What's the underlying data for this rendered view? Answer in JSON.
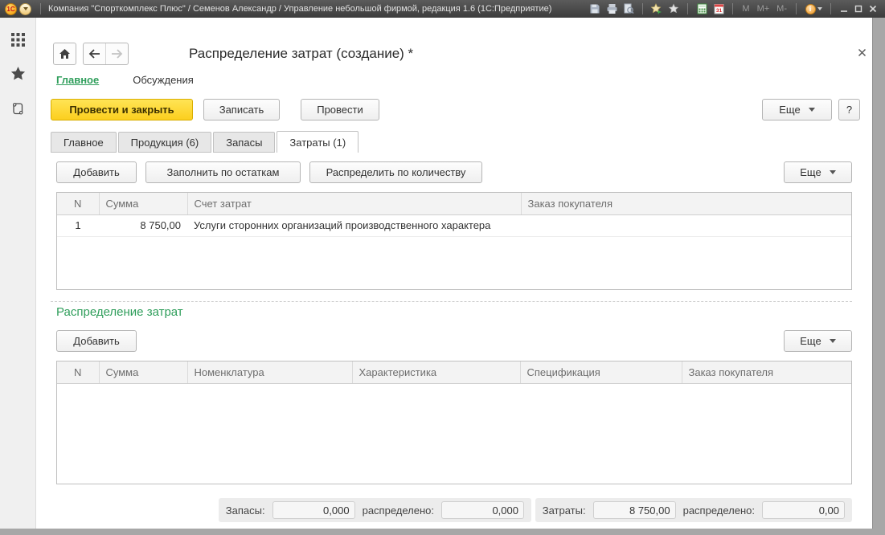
{
  "titlebar": {
    "logo_text": "1С",
    "title": "Компания \"Спорткомплекс Плюс\" / Семенов Александр / Управление небольшой фирмой, редакция 1.6  (1С:Предприятие)",
    "calendar_text": "31",
    "memory": [
      "M",
      "M+",
      "M-"
    ]
  },
  "form": {
    "title": "Распределение затрат (создание) *",
    "nav": {
      "main": "Главное",
      "discussions": "Обсуждения"
    }
  },
  "commands": {
    "post_and_close": "Провести и закрыть",
    "write": "Записать",
    "post": "Провести",
    "more": "Еще",
    "help": "?"
  },
  "tabs": [
    {
      "label": "Главное"
    },
    {
      "label": "Продукция (6)"
    },
    {
      "label": "Запасы"
    },
    {
      "label": "Затраты (1)"
    }
  ],
  "costs_section": {
    "toolbar": {
      "add": "Добавить",
      "fill_by_balance": "Заполнить по остаткам",
      "distribute_by_qty": "Распределить по количеству",
      "more": "Еще"
    },
    "table": {
      "columns": [
        "N",
        "Сумма",
        "Счет затрат",
        "Заказ покупателя"
      ],
      "rows": [
        {
          "n": "1",
          "sum": "8 750,00",
          "account": "Услуги сторонних организаций производственного характера",
          "order": ""
        }
      ]
    }
  },
  "distribution_section": {
    "heading": "Распределение затрат",
    "toolbar": {
      "add": "Добавить",
      "more": "Еще"
    },
    "table": {
      "columns": [
        "N",
        "Сумма",
        "Номенклатура",
        "Характеристика",
        "Спецификация",
        "Заказ покупателя"
      ]
    }
  },
  "footer": {
    "stocks_label": "Запасы:",
    "stocks_value": "0,000",
    "stocks_dist_label": "распределено:",
    "stocks_dist_value": "0,000",
    "costs_label": "Затраты:",
    "costs_value": "8 750,00",
    "costs_dist_label": "распределено:",
    "costs_dist_value": "0,00"
  }
}
